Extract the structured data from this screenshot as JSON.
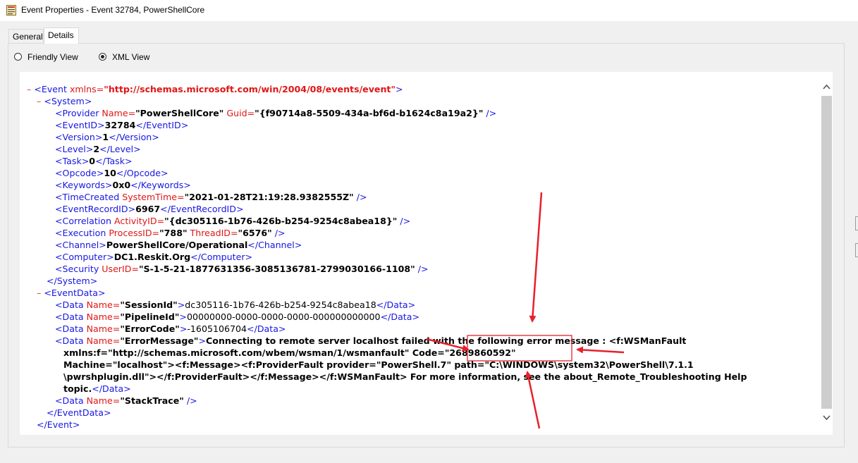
{
  "window": {
    "title": "Event Properties - Event 32784, PowerShellCore"
  },
  "tabs": [
    {
      "label": "General"
    },
    {
      "label": "Details"
    }
  ],
  "view_options": {
    "friendly": {
      "label": "Friendly View",
      "selected": false
    },
    "xml": {
      "label": "XML View",
      "selected": true
    }
  },
  "xml": {
    "minus": "–",
    "event_open": {
      "tag": "<Event",
      "attr": " xmlns=",
      "value": "\"http://schemas.microsoft.com/win/2004/08/events/event\"",
      "close": ">"
    },
    "system_open": "<System>",
    "provider": {
      "tag": "<Provider",
      "attr1": " Name=",
      "val1": "\"PowerShellCore\"",
      "attr2": " Guid=",
      "val2": "\"{f90714a8-5509-434a-bf6d-b1624c8a19a2}\"",
      "close": " />"
    },
    "eventid": {
      "open": "<EventID>",
      "value": "32784",
      "close": "</EventID>"
    },
    "version": {
      "open": "<Version>",
      "value": "1",
      "close": "</Version>"
    },
    "level": {
      "open": "<Level>",
      "value": "2",
      "close": "</Level>"
    },
    "task": {
      "open": "<Task>",
      "value": "0",
      "close": "</Task>"
    },
    "opcode": {
      "open": "<Opcode>",
      "value": "10",
      "close": "</Opcode>"
    },
    "keywords": {
      "open": "<Keywords>",
      "value": "0x0",
      "close": "</Keywords>"
    },
    "timecreated": {
      "tag": "<TimeCreated",
      "attr": " SystemTime=",
      "value": "\"2021-01-28T21:19:28.9382555Z\"",
      "close": " />"
    },
    "eventrecordid": {
      "open": "<EventRecordID>",
      "value": "6967",
      "close": "</EventRecordID>"
    },
    "correlation": {
      "tag": "<Correlation",
      "attr": " ActivityID=",
      "value": "\"{dc305116-1b76-426b-b254-9254c8abea18}\"",
      "close": " />"
    },
    "execution": {
      "tag": "<Execution",
      "attr1": " ProcessID=",
      "val1": "\"788\"",
      "attr2": " ThreadID=",
      "val2": "\"6576\"",
      "close": " />"
    },
    "channel": {
      "open": "<Channel>",
      "value": "PowerShellCore/Operational",
      "close": "</Channel>"
    },
    "computer": {
      "open": "<Computer>",
      "value": "DC1.Reskit.Org",
      "close": "</Computer>"
    },
    "security": {
      "tag": "<Security",
      "attr": " UserID=",
      "value": "\"S-1-5-21-1877631356-3085136781-2799030166-1108\"",
      "close": " />"
    },
    "system_close": "</System>",
    "eventdata_open": "<EventData>",
    "data_tag": "<Data",
    "data_attr": " Name=",
    "data_close_tag": "</Data>",
    "session": {
      "name": "\"SessionId\"",
      "value": "dc305116-1b76-426b-b254-9254c8abea18"
    },
    "pipeline": {
      "name": "\"PipelineId\"",
      "value": "00000000-0000-0000-0000-000000000000"
    },
    "errorcode": {
      "name": "\"ErrorCode\"",
      "value": "-1605106704"
    },
    "errormessage": {
      "name": "\"ErrorMessage\"",
      "line1": "Connecting to remote server localhost failed with the following error message : <f:WSManFault",
      "line2": "xmlns:f=\"http://schemas.microsoft.com/wbem/wsman/1/wsmanfault\" Code=\"2689860592\"",
      "line3": "Machine=\"localhost\"><f:Message><f:ProviderFault provider=\"PowerShell.7\" path=\"C:\\WINDOWS\\system32\\PowerShell\\7.1.1",
      "line4": "\\pwrshplugin.dll\"></f:ProviderFault></f:Message></f:WSManFault> For more information, see the about_Remote_Troubleshooting Help",
      "line5": "topic."
    },
    "stacktrace": {
      "name": "\"StackTrace\"",
      "close": " />"
    },
    "eventdata_close": "</EventData>",
    "event_close": "</Event>"
  },
  "colors": {
    "tag_blue": "#1717e2",
    "attr_red": "#e01616",
    "annotation_red": "#e8202a",
    "scroll_track": "#cdcdcd"
  }
}
